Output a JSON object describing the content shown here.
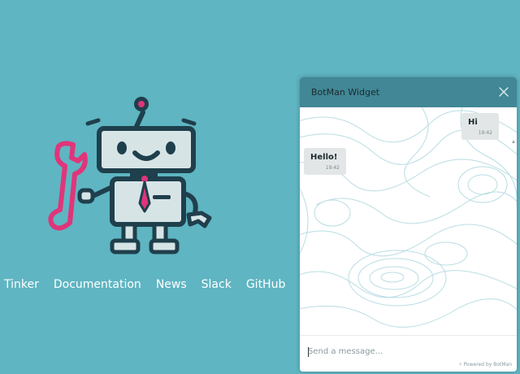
{
  "nav": {
    "links": [
      "Tinker",
      "Documentation",
      "News",
      "Slack",
      "GitHub"
    ]
  },
  "chat": {
    "title": "BotMan Widget",
    "messages": [
      {
        "text": "Hi",
        "time": "19:42",
        "from": "user"
      },
      {
        "text": "Hello!",
        "time": "19:42",
        "from": "bot"
      }
    ],
    "input_placeholder": "Send a message...",
    "powered_by": "Powered by BotMan"
  },
  "colors": {
    "page_bg": "#5fb5c2",
    "header_bg": "#418795",
    "robot_outline": "#1f3f4c",
    "wrench": "#e0357a",
    "bubble_bg": "#e2e6e7"
  },
  "icons": [
    "robot-logo",
    "wrench-icon",
    "close-icon",
    "lightning-icon"
  ]
}
